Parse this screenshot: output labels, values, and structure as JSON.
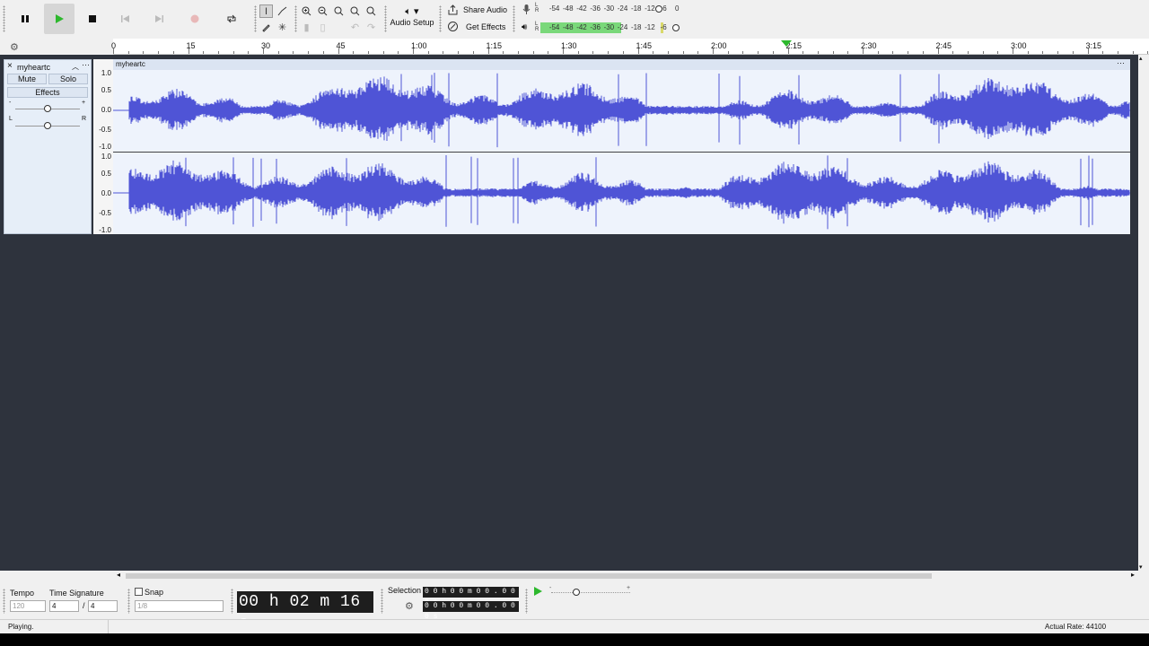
{
  "toolbar": {
    "audio_setup": "Audio Setup",
    "share_audio": "Share Audio",
    "get_effects": "Get Effects",
    "rec_meter_scale": [
      "-54",
      "-48",
      "-42",
      "-36",
      "-30",
      "-24",
      "-18",
      "-12",
      "-6",
      "0"
    ],
    "play_meter_scale": [
      "-54",
      "-48",
      "-42",
      "-36",
      "-30",
      "-24",
      "-18",
      "-12",
      "-6"
    ],
    "rec_meter_lr": [
      "L",
      "R"
    ],
    "play_meter_lr": [
      "L",
      "R"
    ],
    "playback_level": 0.64
  },
  "ruler": {
    "ticks": [
      "0",
      "15",
      "30",
      "45",
      "1:00",
      "1:15",
      "1:30",
      "1:45",
      "2:00",
      "2:15",
      "2:30",
      "2:45",
      "3:00",
      "3:15"
    ]
  },
  "track": {
    "name": "myheartc",
    "clip_name": "myheartc",
    "mute": "Mute",
    "solo": "Solo",
    "effects": "Effects",
    "gain_minus": "-",
    "gain_plus": "+",
    "pan_left": "L",
    "pan_right": "R",
    "amplitude_labels": [
      "1.0",
      "0.5",
      "0.0",
      "-0.5",
      "-1.0"
    ]
  },
  "bottom": {
    "tempo_label": "Tempo",
    "tempo_value": "120",
    "time_signature_label": "Time Signature",
    "time_sig_top": "4",
    "time_sig_slash": "/",
    "time_sig_bottom": "4",
    "snap_label": "Snap",
    "snap_value": "1/8",
    "time_display": "00 h 02 m 16 s",
    "selection_label": "Selection",
    "selection_start": "0 0 h 0 0 m 0 0 . 0 0 0 s",
    "selection_end": "0 0 h 0 0 m 0 0 . 0 0 0 s"
  },
  "status": {
    "state": "Playing.",
    "rate": "Actual Rate: 44100"
  },
  "colors": {
    "waveform": "#4f54d6",
    "track_bg": "#eef3fc",
    "background": "#2e333d",
    "meter_green": "#7ad87a",
    "play_green": "#2db82d"
  }
}
